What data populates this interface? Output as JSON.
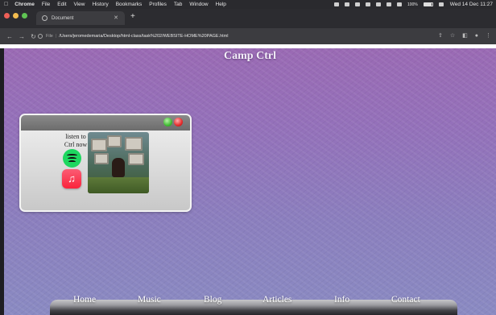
{
  "os_menubar": {
    "app_name": "Chrome",
    "menus": [
      "File",
      "Edit",
      "View",
      "History",
      "Bookmarks",
      "Profiles",
      "Tab",
      "Window",
      "Help"
    ],
    "battery_percent": "100%",
    "clock": "Wed 14 Dec 11:27"
  },
  "browser": {
    "tab_title": "Document",
    "new_tab_symbol": "+",
    "address_prefix": "File",
    "url": "/Users/jeromedemaria/Desktop/html-class/task%202/WEBSITE-HOME%20PAGE.html"
  },
  "site": {
    "title": "Camp Ctrl"
  },
  "music_window": {
    "listen_text": "listen to Ctrl now",
    "streaming_icons": [
      "spotify-icon",
      "apple-music-icon"
    ],
    "control_colors": {
      "green": "#3fbb32",
      "red": "#e52a2a"
    }
  },
  "nav": {
    "links": [
      "Home",
      "Music",
      "Blog",
      "Articles",
      "Info",
      "Contact"
    ]
  },
  "colors": {
    "page_top": "#9a6ab4",
    "page_bottom": "#8a8ac2",
    "spotify": "#1ed760",
    "apple_music": "#fa233b"
  }
}
